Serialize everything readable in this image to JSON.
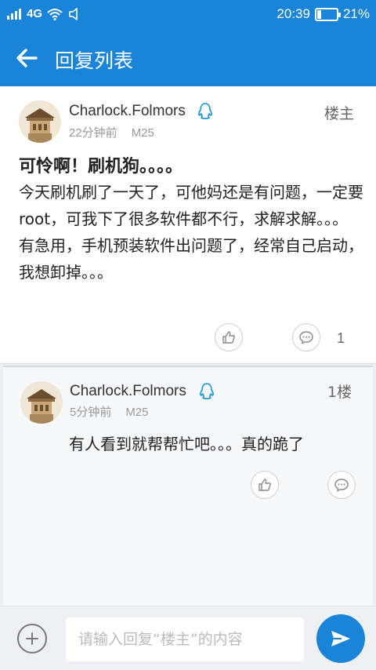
{
  "status_bar": {
    "network": "4G",
    "time": "20:39",
    "battery": "21%",
    "battery_level": 0.21
  },
  "header": {
    "title": "回复列表"
  },
  "post": {
    "author": "Charlock.Folmors",
    "time_ago": "22分钟前",
    "device": "M25",
    "floor": "楼主",
    "title": "可怜啊！刷机狗。。。。",
    "body": "今天刷机刷了一天了，可他妈还是有问题，一定要root，可我下了很多软件都不行，求解求解。。。有急用，手机预装软件出问题了，经常自己启动，我想卸掉。。。",
    "reply_count": "1"
  },
  "reply": {
    "author": "Charlock.Folmors",
    "time_ago": "5分钟前",
    "device": "M25",
    "floor": "1楼",
    "body": "有人看到就帮帮忙吧。。。真的跪了"
  },
  "composer": {
    "placeholder": "请输入回复“楼主”的内容"
  },
  "icons": {
    "back": "arrow-left-icon",
    "qq": "qq-penguin-icon",
    "like": "thumbs-up-icon",
    "comment": "comment-bubble-icon",
    "add": "plus-icon",
    "send": "paper-plane-icon"
  },
  "colors": {
    "primary": "#1a84d8",
    "qq_icon": "#2a9bd8"
  }
}
